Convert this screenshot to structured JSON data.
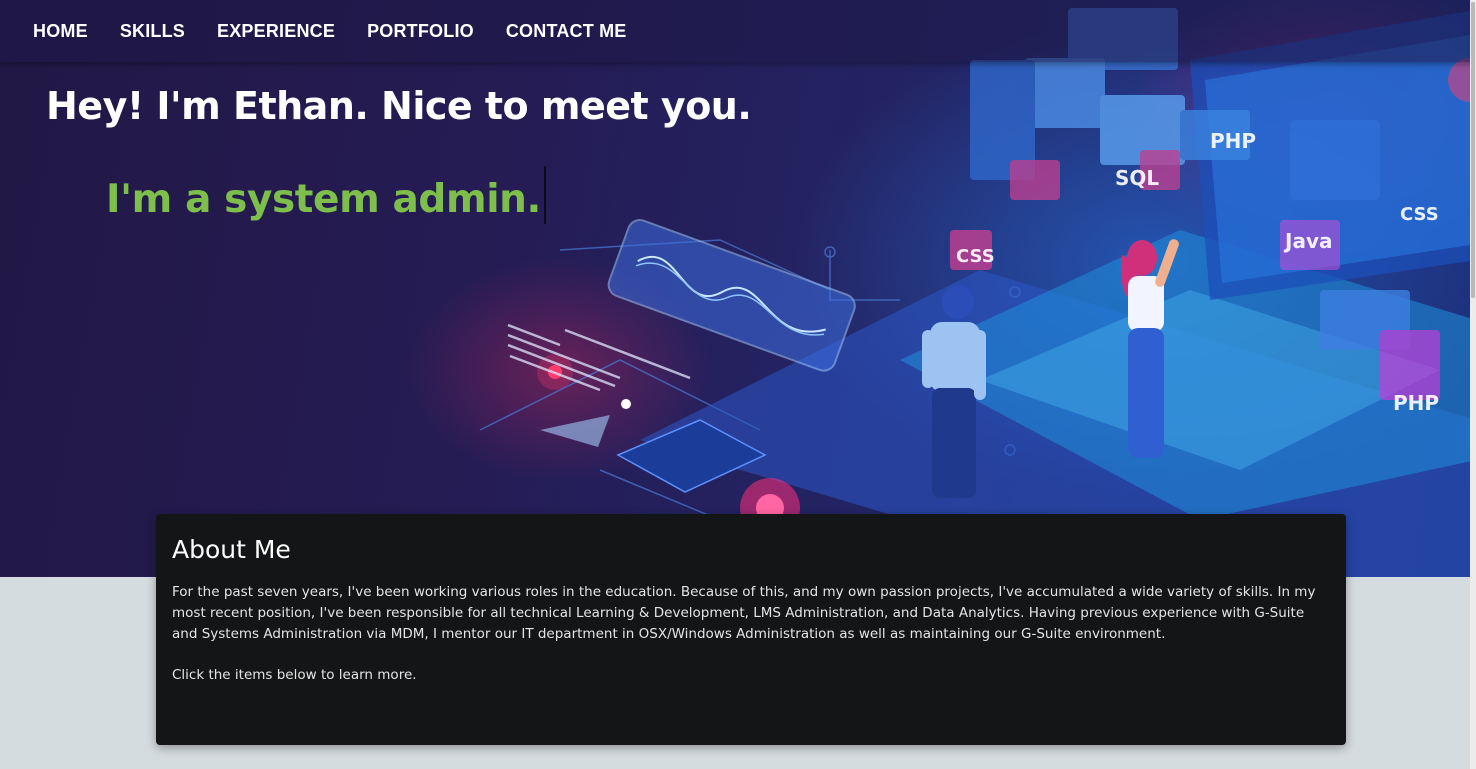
{
  "nav": {
    "items": [
      {
        "label": "HOME"
      },
      {
        "label": "SKILLS"
      },
      {
        "label": "EXPERIENCE"
      },
      {
        "label": "PORTFOLIO"
      },
      {
        "label": "CONTACT ME"
      }
    ]
  },
  "hero": {
    "headline": "Hey! I'm Ethan. Nice to meet you.",
    "typed_text": "I'm a system admin.",
    "illustration_labels": {
      "sql_tag": "SQL",
      "php_tag": "PHP",
      "css_tag": "CSS",
      "java_tag": "Java",
      "php_tag_2": "PHP",
      "css_tag_2": "CSS"
    }
  },
  "about": {
    "title": "About Me",
    "body": "For the past seven years, I've been working various roles in the education. Because of this, and my own passion projects, I've accumulated a wide variety of skills. In my most recent position, I've been responsible for all technical Learning & Development, LMS Administration, and Data Analytics. Having previous experience with G-Suite and Systems Administration via MDM, I mentor our IT department in OSX/Windows Administration as well as maintaining our G-Suite environment.",
    "cta": "Click the items below to learn more."
  },
  "colors": {
    "accent_green": "#7dbf4a",
    "card_bg": "#141516",
    "page_bg": "#d5dce0"
  }
}
